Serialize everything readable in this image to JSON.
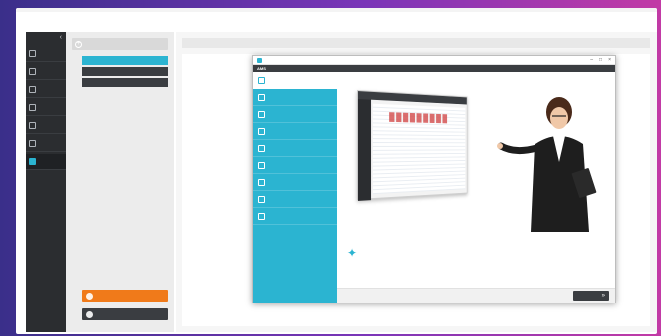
{
  "colors": {
    "accent": "#2bb4d1",
    "nav_bg": "#2b2d30",
    "orange": "#f07a1a",
    "link": "#3e7fbf",
    "dark": "#3a3d41"
  },
  "nav": {
    "back_icon": "chevron-left-icon",
    "items": [
      {
        "label": "",
        "icon": "home-icon"
      },
      {
        "label": "",
        "icon": "calendar-icon"
      },
      {
        "label": "",
        "icon": "table-icon"
      },
      {
        "label": "",
        "icon": "wallet-icon"
      },
      {
        "label": "",
        "icon": "document-icon"
      },
      {
        "label": "",
        "icon": "tools-icon"
      },
      {
        "label": "",
        "icon": "help-icon"
      }
    ]
  },
  "subpanel": {
    "header": "",
    "items": [
      "",
      "",
      ""
    ],
    "cta_primary": "",
    "cta_secondary": ""
  },
  "main": {
    "breadcrumb": "",
    "title": "",
    "subtitle": "",
    "links": [
      "",
      "",
      "",
      "",
      ""
    ]
  },
  "dialog": {
    "window_title": "",
    "app_name": "AMS",
    "controls": [
      "–",
      "□",
      "×"
    ],
    "menu": [
      {
        "label": "",
        "icon": "person-icon"
      },
      {
        "label": "",
        "icon": "arrows-icon"
      },
      {
        "label": "",
        "icon": "network-icon"
      },
      {
        "label": "",
        "icon": "people-icon"
      },
      {
        "label": "",
        "icon": "camera-icon"
      },
      {
        "label": "",
        "icon": "list-icon"
      },
      {
        "label": "",
        "icon": "trophy-icon"
      },
      {
        "label": "",
        "icon": "quote-icon"
      },
      {
        "label": "",
        "icon": "chat-icon"
      }
    ],
    "welcome_text": "",
    "footer_link": "",
    "next_label": ""
  }
}
